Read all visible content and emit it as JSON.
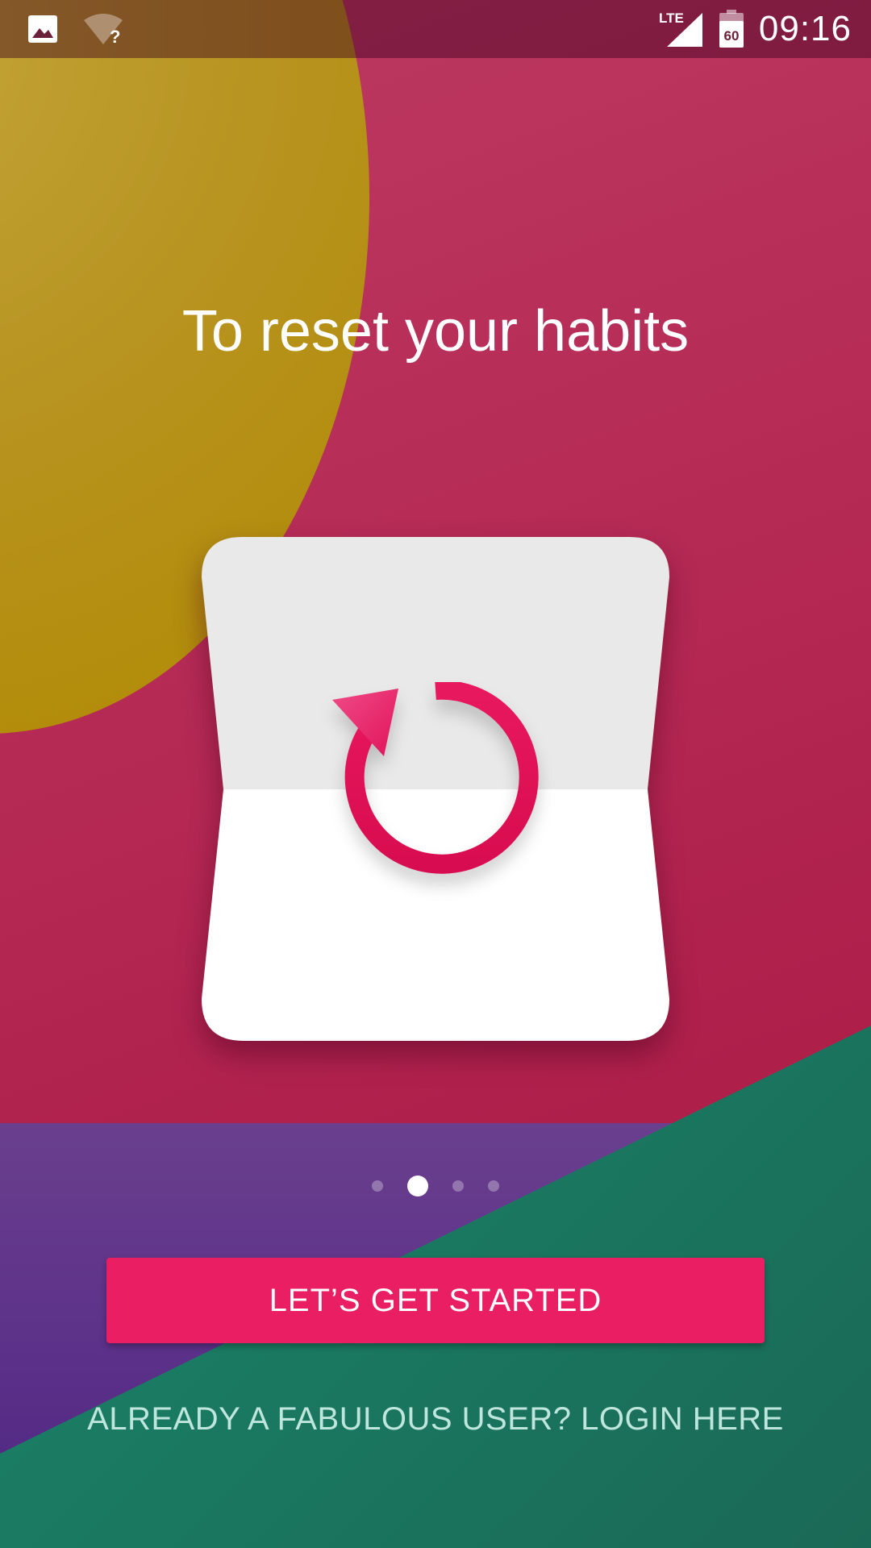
{
  "status_bar": {
    "time": "09:16",
    "network_label": "LTE",
    "battery_level": "60",
    "icons": [
      "image-icon",
      "wifi-question-icon",
      "lte-signal-icon",
      "battery-icon"
    ]
  },
  "onboarding": {
    "headline": "To reset your habits",
    "illustration_icon": "refresh-arrow-icon",
    "page_indicator": {
      "total": 4,
      "active_index": 1
    }
  },
  "actions": {
    "primary_label": "LET’S GET STARTED",
    "login_label": "ALREADY A FABULOUS USER? LOGIN HERE"
  },
  "colors": {
    "accent": "#e91e63",
    "background_magenta": "#b1234f",
    "gold": "#b89421",
    "green": "#1a7c63",
    "purple": "#5a2f88"
  }
}
